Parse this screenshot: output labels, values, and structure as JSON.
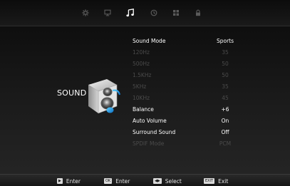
{
  "top_tabs": [
    {
      "name": "picture",
      "icon": "picture-icon",
      "active": false
    },
    {
      "name": "screen",
      "icon": "monitor-icon",
      "active": false
    },
    {
      "name": "sound",
      "icon": "music-note-icon",
      "active": true
    },
    {
      "name": "time",
      "icon": "clock-icon",
      "active": false
    },
    {
      "name": "option",
      "icon": "grid-icon",
      "active": false
    },
    {
      "name": "lock",
      "icon": "lock-icon",
      "active": false
    }
  ],
  "section": {
    "label": "SOUND",
    "icon": "speaker-with-note-icon"
  },
  "menu": {
    "rows": [
      {
        "label": "Sound Mode",
        "value": "Sports",
        "enabled": true
      },
      {
        "label": "120Hz",
        "value": "35",
        "enabled": false
      },
      {
        "label": "500Hz",
        "value": "50",
        "enabled": false
      },
      {
        "label": "1.5KHz",
        "value": "50",
        "enabled": false
      },
      {
        "label": "5KHz",
        "value": "35",
        "enabled": false
      },
      {
        "label": "10KHz",
        "value": "45",
        "enabled": false
      },
      {
        "label": "Balance",
        "value": "+6",
        "enabled": true
      },
      {
        "label": "Auto Volume",
        "value": "On",
        "enabled": true
      },
      {
        "label": "Surround Sound",
        "value": "Off",
        "enabled": true
      },
      {
        "label": "SPDIF Mode",
        "value": "PCM",
        "enabled": false
      }
    ]
  },
  "bottom_hints": {
    "enter": {
      "key": "▶",
      "label": "Enter"
    },
    "ok": {
      "key": "OK",
      "label": "Enter"
    },
    "select": {
      "key": "◀▶",
      "label": "Select"
    },
    "exit": {
      "key": "EXIT",
      "label": "Exit"
    }
  },
  "colors": {
    "text_enabled": "#ffffff",
    "text_disabled": "#4b4b4b",
    "tab_active": "#ffffff",
    "tab_inactive": "#5a5a5a"
  }
}
